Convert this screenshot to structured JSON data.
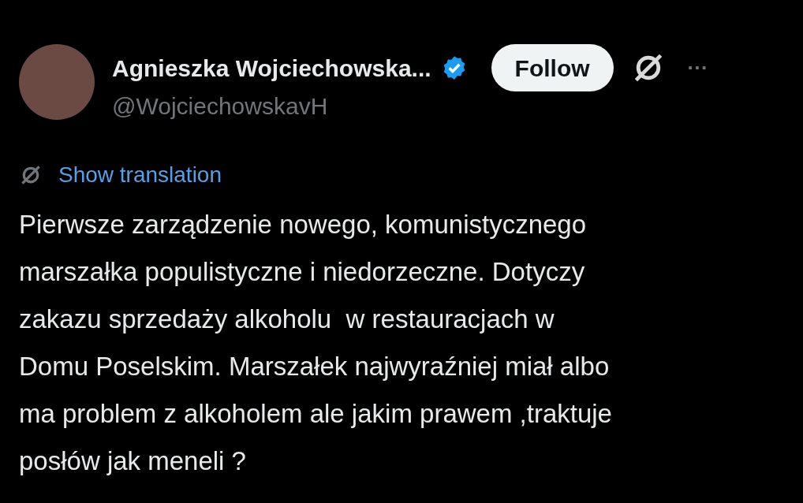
{
  "author": {
    "name": "Agnieszka Wojciechowska...",
    "verified": true,
    "handle": "@WojciechowskavH"
  },
  "follow_button": "Follow",
  "menu_button": "···",
  "translation_link": "Show translation",
  "post_text": "Pierwsze zarządzenie nowego, komunistycznego\nmarszałka populistyczne i niedorzeczne. Dotyczy\nzakazu sprzedaży alkoholu  w restauracjach w\nDomu Poselskim. Marszałek najwyraźniej miał albo\nma problem z alkoholem ale jakim prawem ,traktuje\nposłów jak meneli ?"
}
